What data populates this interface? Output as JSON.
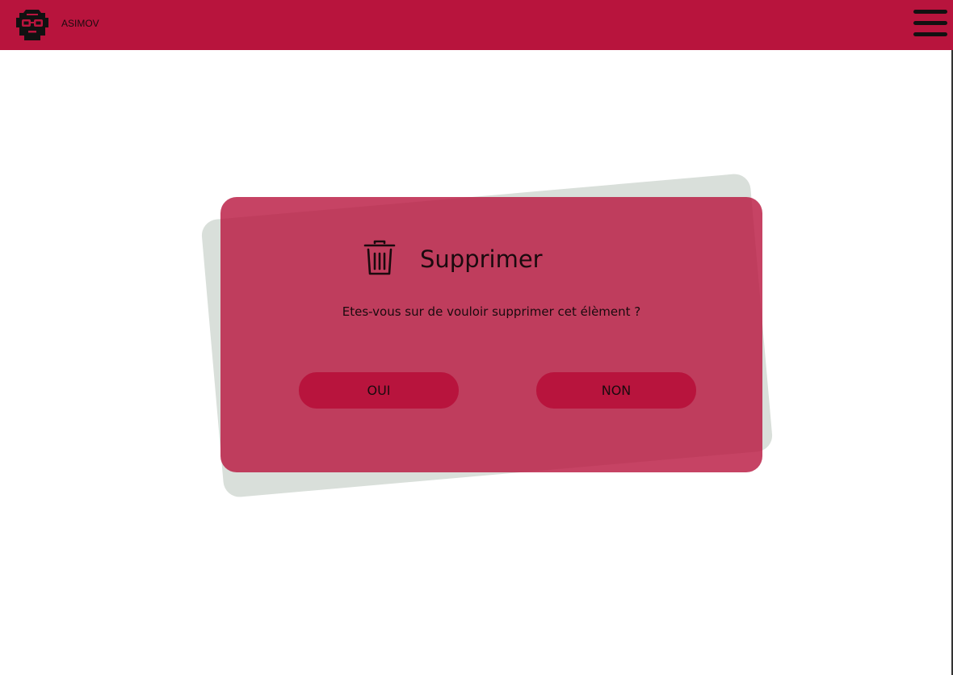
{
  "header": {
    "brand": "ASIMOV",
    "logo_icon": "robot-head-icon",
    "menu_icon": "hamburger-menu-icon",
    "background_color": "#b8143d"
  },
  "dialog": {
    "icon": "trash-icon",
    "title": "Supprimer",
    "message": "Etes-vous sur de vouloir supprimer cet élèment ?",
    "confirm_label": "OUI",
    "cancel_label": "NON",
    "panel_color": "#b8143d",
    "backdrop_color": "#d9dfda"
  }
}
